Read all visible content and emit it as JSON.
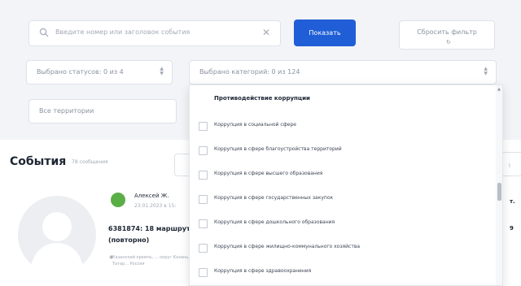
{
  "filters": {
    "search_placeholder": "Введите номер или заголовок события",
    "clear_glyph": "✕",
    "show_label": "Показать",
    "reset_label": "Сбросить фильтр",
    "reset_icon": "↻",
    "status_select": "Выбрано статусов: 0 из 4",
    "territory_select": "Все территории",
    "category_select": "Выбрано категорий: 0 из 124",
    "select_arrows": "▲▼"
  },
  "events": {
    "title": "События",
    "count": "78 сообщения",
    "card": {
      "author": "Алексей Ж.",
      "date": "23.01.2023 в 15:",
      "title_line1": "6381874: 18 маршрут",
      "title_line2": "(повторно)",
      "address": "Казанский кремль, ... округ Казань, Татар... Россия",
      "right_fragments": [
        "т.",
        "9"
      ]
    },
    "right_stub_text": "i"
  },
  "dropdown": {
    "header": "Противодействие коррупции",
    "items": [
      "Коррупция в социальной сфере",
      "Коррупция в сфере благоустройства территорий",
      "Коррупция в сфере высшего образования",
      "Коррупция в сфере государственных закупок",
      "Коррупция в сфере дошкольного образования",
      "Коррупция в сфере жилищно-коммунального хозяйства",
      "Коррупция в сфере здравоохранения"
    ]
  }
}
